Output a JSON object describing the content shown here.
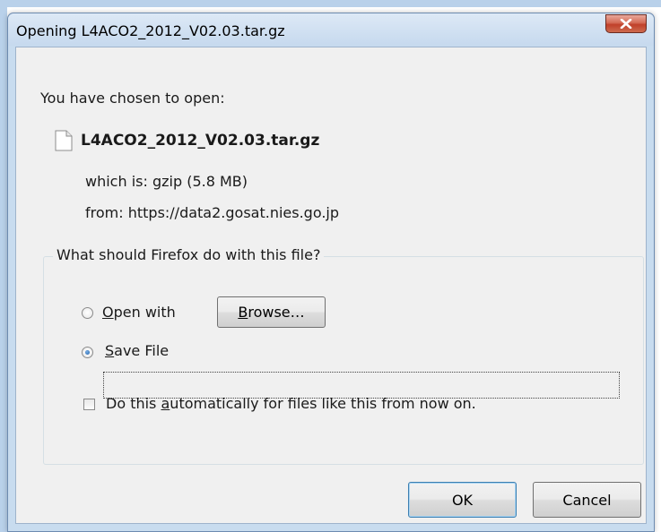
{
  "dialog": {
    "title": "Opening L4ACO2_2012_V02.03.tar.gz",
    "close_label": "x"
  },
  "file_info": {
    "intro": "You have chosen to open:",
    "filename": "L4ACO2_2012_V02.03.tar.gz",
    "which_is_label": "which is:",
    "which_is_value": "gzip (5.8 MB)",
    "from_label": "from:",
    "from_value": "https://data2.gosat.nies.go.jp"
  },
  "action_group": {
    "legend": "What should Firefox do with this file?",
    "open_with": {
      "accesskey": "O",
      "rest": "pen with",
      "checked": false
    },
    "browse": {
      "accesskey": "B",
      "rest": "rowse…"
    },
    "save_file": {
      "accesskey": "S",
      "rest": "ave File",
      "checked": true
    },
    "auto": {
      "before": "Do this ",
      "accesskey": "a",
      "after": "utomatically for files like this from now on.",
      "checked": false
    }
  },
  "buttons": {
    "ok": "OK",
    "cancel": "Cancel"
  }
}
